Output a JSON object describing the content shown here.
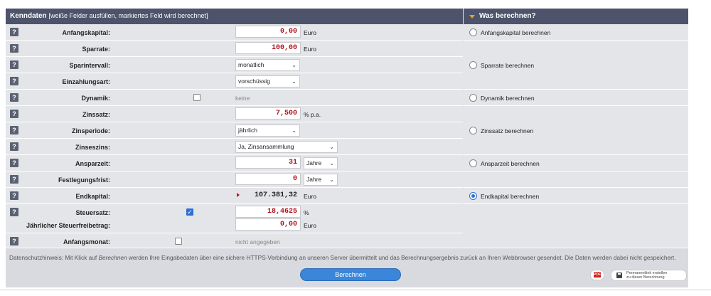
{
  "header": {
    "title": "Kenndaten",
    "subtitle": "[weiße Felder ausfüllen, markiertes Feld wird berechnet]",
    "right_title": "Was berechnen?"
  },
  "help_glyph": "?",
  "rows": {
    "anfangskapital": {
      "label": "Anfangskapital:",
      "value": "0,00",
      "unit": "Euro"
    },
    "sparrate": {
      "label": "Sparrate:",
      "value": "100,00",
      "unit": "Euro"
    },
    "sparintervall": {
      "label": "Sparintervall:",
      "selected": "monatlich"
    },
    "einzahlungsart": {
      "label": "Einzahlungsart:",
      "selected": "vorschüssig"
    },
    "dynamik": {
      "label": "Dynamik:",
      "checked": false,
      "value_text": "keine"
    },
    "zinssatz": {
      "label": "Zinssatz:",
      "value": "7,500",
      "unit": "% p.a."
    },
    "zinsperiode": {
      "label": "Zinsperiode:",
      "selected": "jährlich"
    },
    "zinseszins": {
      "label": "Zinseszins:",
      "selected": "Ja, Zinsansammlung"
    },
    "ansparzeit": {
      "label": "Ansparzeit:",
      "value": "31",
      "unit_selected": "Jahre"
    },
    "festlegungsfrist": {
      "label": "Festlegungsfrist:",
      "value": "0",
      "unit_selected": "Jahre"
    },
    "endkapital": {
      "label": "Endkapital:",
      "value": "107.381,32",
      "unit": "Euro"
    },
    "steuersatz": {
      "label": "Steuersatz:",
      "checked": true,
      "value": "18,4625",
      "unit": "%"
    },
    "freibetrag": {
      "label": "Jährlicher Steuerfreibetrag:",
      "value": "0,00",
      "unit": "Euro"
    },
    "anfangsmonat": {
      "label": "Anfangsmonat:",
      "checked": false,
      "value_text": "nicht angegeben"
    }
  },
  "radios": {
    "anfangskapital": {
      "label": "Anfangskapital berechnen",
      "selected": false
    },
    "sparrate": {
      "label": "Sparrate berechnen",
      "selected": false
    },
    "dynamik": {
      "label": "Dynamik berechnen",
      "selected": false
    },
    "zinssatz": {
      "label": "Zinssatz berechnen",
      "selected": false
    },
    "ansparzeit": {
      "label": "Ansparzeit berechnen",
      "selected": false
    },
    "endkapital": {
      "label": "Endkapital berechnen",
      "selected": true
    }
  },
  "footer": {
    "note_pre": "Datenschutzhinweis: Mit Klick auf ",
    "note_em": "Berechnen",
    "note_post": " werden Ihre Eingabedaten über eine sichere HTTPS-Verbindung an unseren Server übermittelt und das Berechnungsergebnis zurück an Ihren Webbrowser gesendet. Die Daten werden dabei nicht gespeichert.",
    "calc_button": "Berechnen",
    "pdf_label": "PDF",
    "permalink_line1": "Permanentlink erstellen",
    "permalink_line2": "zu dieser Berechnung"
  },
  "colors": {
    "header_bg": "#4c536a",
    "value_red": "#b0141e",
    "accent_blue": "#3a86d8"
  }
}
